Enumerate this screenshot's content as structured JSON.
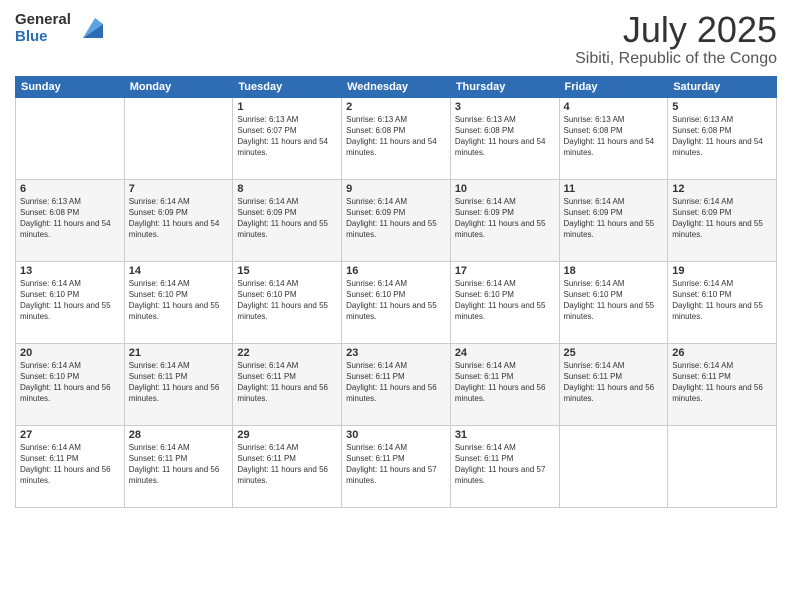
{
  "logo": {
    "general": "General",
    "blue": "Blue"
  },
  "title": {
    "month_year": "July 2025",
    "location": "Sibiti, Republic of the Congo"
  },
  "weekdays": [
    "Sunday",
    "Monday",
    "Tuesday",
    "Wednesday",
    "Thursday",
    "Friday",
    "Saturday"
  ],
  "weeks": [
    [
      {
        "day": "",
        "sunrise": "",
        "sunset": "",
        "daylight": ""
      },
      {
        "day": "",
        "sunrise": "",
        "sunset": "",
        "daylight": ""
      },
      {
        "day": "1",
        "sunrise": "Sunrise: 6:13 AM",
        "sunset": "Sunset: 6:07 PM",
        "daylight": "Daylight: 11 hours and 54 minutes."
      },
      {
        "day": "2",
        "sunrise": "Sunrise: 6:13 AM",
        "sunset": "Sunset: 6:08 PM",
        "daylight": "Daylight: 11 hours and 54 minutes."
      },
      {
        "day": "3",
        "sunrise": "Sunrise: 6:13 AM",
        "sunset": "Sunset: 6:08 PM",
        "daylight": "Daylight: 11 hours and 54 minutes."
      },
      {
        "day": "4",
        "sunrise": "Sunrise: 6:13 AM",
        "sunset": "Sunset: 6:08 PM",
        "daylight": "Daylight: 11 hours and 54 minutes."
      },
      {
        "day": "5",
        "sunrise": "Sunrise: 6:13 AM",
        "sunset": "Sunset: 6:08 PM",
        "daylight": "Daylight: 11 hours and 54 minutes."
      }
    ],
    [
      {
        "day": "6",
        "sunrise": "Sunrise: 6:13 AM",
        "sunset": "Sunset: 6:08 PM",
        "daylight": "Daylight: 11 hours and 54 minutes."
      },
      {
        "day": "7",
        "sunrise": "Sunrise: 6:14 AM",
        "sunset": "Sunset: 6:09 PM",
        "daylight": "Daylight: 11 hours and 54 minutes."
      },
      {
        "day": "8",
        "sunrise": "Sunrise: 6:14 AM",
        "sunset": "Sunset: 6:09 PM",
        "daylight": "Daylight: 11 hours and 55 minutes."
      },
      {
        "day": "9",
        "sunrise": "Sunrise: 6:14 AM",
        "sunset": "Sunset: 6:09 PM",
        "daylight": "Daylight: 11 hours and 55 minutes."
      },
      {
        "day": "10",
        "sunrise": "Sunrise: 6:14 AM",
        "sunset": "Sunset: 6:09 PM",
        "daylight": "Daylight: 11 hours and 55 minutes."
      },
      {
        "day": "11",
        "sunrise": "Sunrise: 6:14 AM",
        "sunset": "Sunset: 6:09 PM",
        "daylight": "Daylight: 11 hours and 55 minutes."
      },
      {
        "day": "12",
        "sunrise": "Sunrise: 6:14 AM",
        "sunset": "Sunset: 6:09 PM",
        "daylight": "Daylight: 11 hours and 55 minutes."
      }
    ],
    [
      {
        "day": "13",
        "sunrise": "Sunrise: 6:14 AM",
        "sunset": "Sunset: 6:10 PM",
        "daylight": "Daylight: 11 hours and 55 minutes."
      },
      {
        "day": "14",
        "sunrise": "Sunrise: 6:14 AM",
        "sunset": "Sunset: 6:10 PM",
        "daylight": "Daylight: 11 hours and 55 minutes."
      },
      {
        "day": "15",
        "sunrise": "Sunrise: 6:14 AM",
        "sunset": "Sunset: 6:10 PM",
        "daylight": "Daylight: 11 hours and 55 minutes."
      },
      {
        "day": "16",
        "sunrise": "Sunrise: 6:14 AM",
        "sunset": "Sunset: 6:10 PM",
        "daylight": "Daylight: 11 hours and 55 minutes."
      },
      {
        "day": "17",
        "sunrise": "Sunrise: 6:14 AM",
        "sunset": "Sunset: 6:10 PM",
        "daylight": "Daylight: 11 hours and 55 minutes."
      },
      {
        "day": "18",
        "sunrise": "Sunrise: 6:14 AM",
        "sunset": "Sunset: 6:10 PM",
        "daylight": "Daylight: 11 hours and 55 minutes."
      },
      {
        "day": "19",
        "sunrise": "Sunrise: 6:14 AM",
        "sunset": "Sunset: 6:10 PM",
        "daylight": "Daylight: 11 hours and 55 minutes."
      }
    ],
    [
      {
        "day": "20",
        "sunrise": "Sunrise: 6:14 AM",
        "sunset": "Sunset: 6:10 PM",
        "daylight": "Daylight: 11 hours and 56 minutes."
      },
      {
        "day": "21",
        "sunrise": "Sunrise: 6:14 AM",
        "sunset": "Sunset: 6:11 PM",
        "daylight": "Daylight: 11 hours and 56 minutes."
      },
      {
        "day": "22",
        "sunrise": "Sunrise: 6:14 AM",
        "sunset": "Sunset: 6:11 PM",
        "daylight": "Daylight: 11 hours and 56 minutes."
      },
      {
        "day": "23",
        "sunrise": "Sunrise: 6:14 AM",
        "sunset": "Sunset: 6:11 PM",
        "daylight": "Daylight: 11 hours and 56 minutes."
      },
      {
        "day": "24",
        "sunrise": "Sunrise: 6:14 AM",
        "sunset": "Sunset: 6:11 PM",
        "daylight": "Daylight: 11 hours and 56 minutes."
      },
      {
        "day": "25",
        "sunrise": "Sunrise: 6:14 AM",
        "sunset": "Sunset: 6:11 PM",
        "daylight": "Daylight: 11 hours and 56 minutes."
      },
      {
        "day": "26",
        "sunrise": "Sunrise: 6:14 AM",
        "sunset": "Sunset: 6:11 PM",
        "daylight": "Daylight: 11 hours and 56 minutes."
      }
    ],
    [
      {
        "day": "27",
        "sunrise": "Sunrise: 6:14 AM",
        "sunset": "Sunset: 6:11 PM",
        "daylight": "Daylight: 11 hours and 56 minutes."
      },
      {
        "day": "28",
        "sunrise": "Sunrise: 6:14 AM",
        "sunset": "Sunset: 6:11 PM",
        "daylight": "Daylight: 11 hours and 56 minutes."
      },
      {
        "day": "29",
        "sunrise": "Sunrise: 6:14 AM",
        "sunset": "Sunset: 6:11 PM",
        "daylight": "Daylight: 11 hours and 56 minutes."
      },
      {
        "day": "30",
        "sunrise": "Sunrise: 6:14 AM",
        "sunset": "Sunset: 6:11 PM",
        "daylight": "Daylight: 11 hours and 57 minutes."
      },
      {
        "day": "31",
        "sunrise": "Sunrise: 6:14 AM",
        "sunset": "Sunset: 6:11 PM",
        "daylight": "Daylight: 11 hours and 57 minutes."
      },
      {
        "day": "",
        "sunrise": "",
        "sunset": "",
        "daylight": ""
      },
      {
        "day": "",
        "sunrise": "",
        "sunset": "",
        "daylight": ""
      }
    ]
  ]
}
